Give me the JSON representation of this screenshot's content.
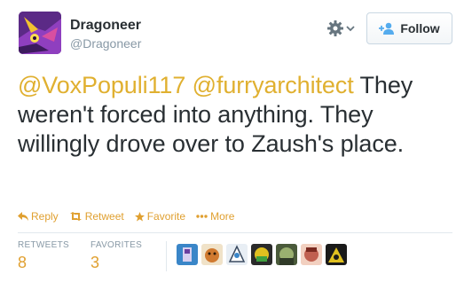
{
  "header": {
    "display_name": "Dragoneer",
    "handle": "@Dragoneer",
    "follow_label": "Follow"
  },
  "tweet": {
    "mention_1": "@VoxPopuli117",
    "mention_2": "@furryarchitect",
    "body": "They weren't forced into anything. They willingly drove over to Zaush's place."
  },
  "actions": {
    "reply": "Reply",
    "retweet": "Retweet",
    "favorite": "Favorite",
    "more": "More"
  },
  "stats": {
    "retweets_label": "RETWEETS",
    "retweets_value": "8",
    "favorites_label": "FAVORITES",
    "favorites_value": "3"
  },
  "favoriters_count": 7,
  "colors": {
    "accent": "#e0a030",
    "mention": "#e0b030",
    "text": "#292f33",
    "muted": "#8899a6"
  },
  "icons": [
    "gear-icon",
    "chevron-down-icon",
    "add-user-icon",
    "reply-icon",
    "retweet-icon",
    "star-icon",
    "ellipsis-icon"
  ]
}
